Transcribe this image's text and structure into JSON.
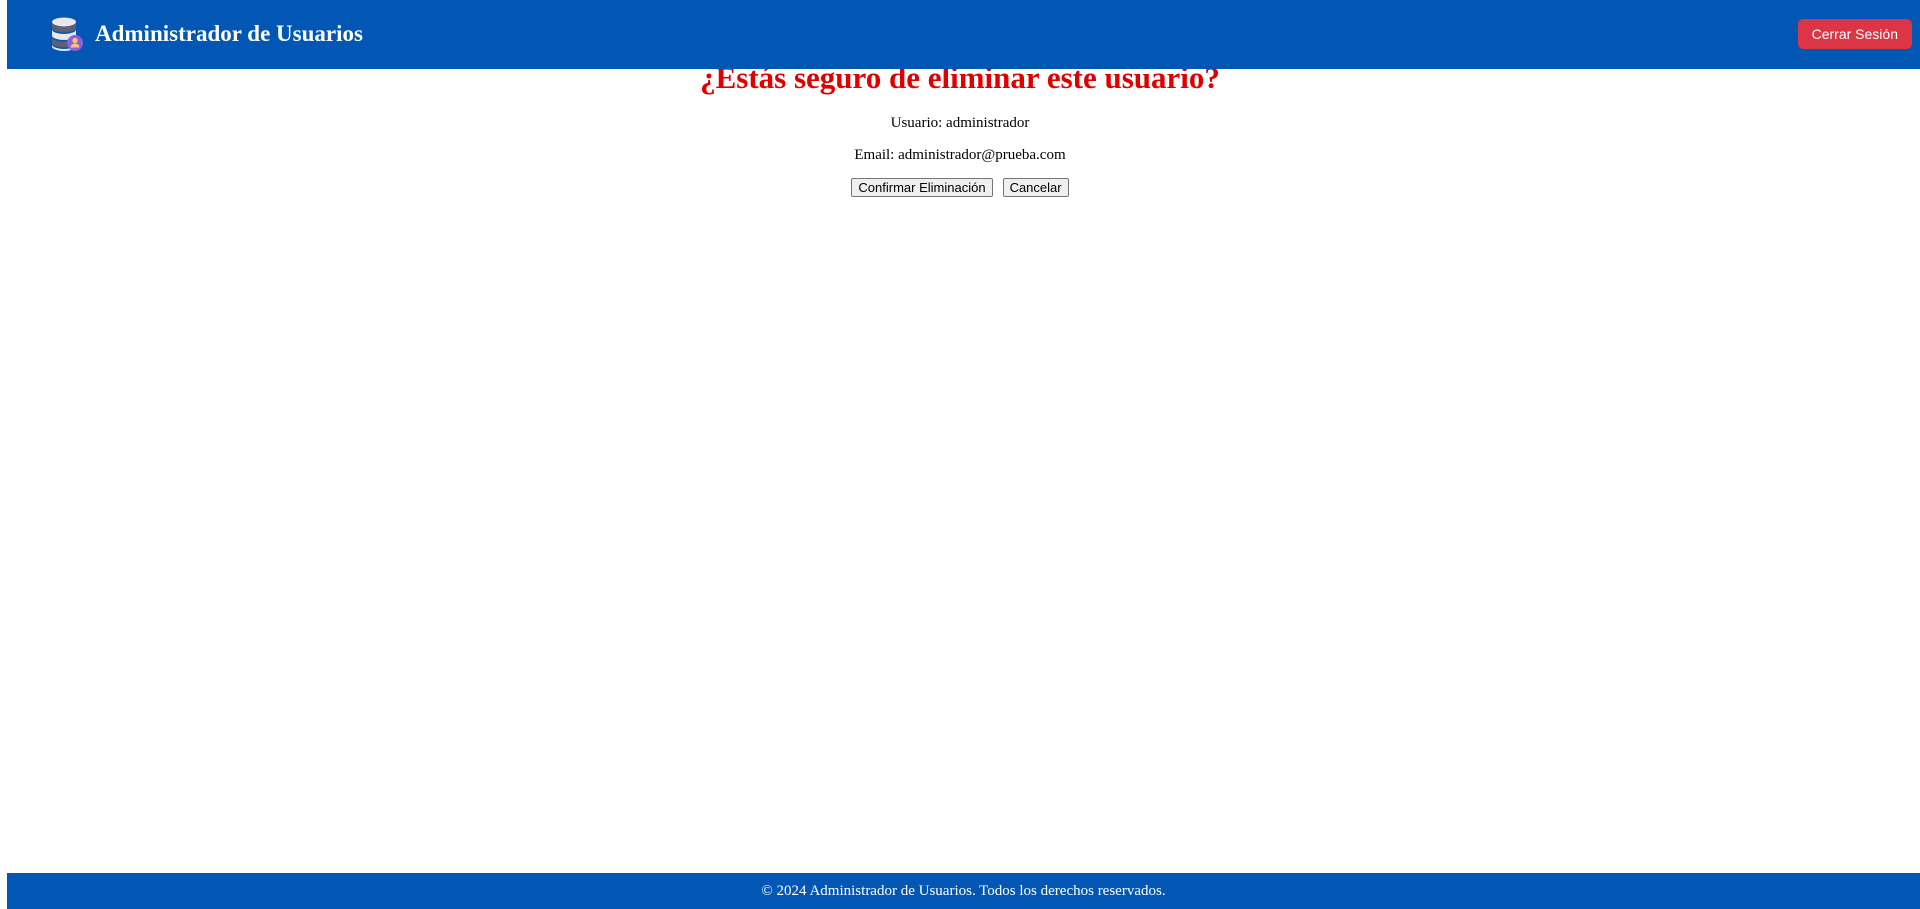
{
  "header": {
    "logo_icon": "database-user-icon",
    "title": "Administrador de Usuarios",
    "logout_label": "Cerrar Sesión"
  },
  "confirm": {
    "title": "¿Estás seguro de eliminar este usuario?",
    "user_line": "Usuario: administrador",
    "email_line": "Email: administrador@prueba.com",
    "confirm_label": "Confirmar Eliminación",
    "cancel_label": "Cancelar"
  },
  "footer": {
    "text": "© 2024 Administrador de Usuarios. Todos los derechos reservados."
  },
  "colors": {
    "header_bg": "#0257b5",
    "logout_bg": "#dc3545",
    "title_color": "#e00000"
  }
}
